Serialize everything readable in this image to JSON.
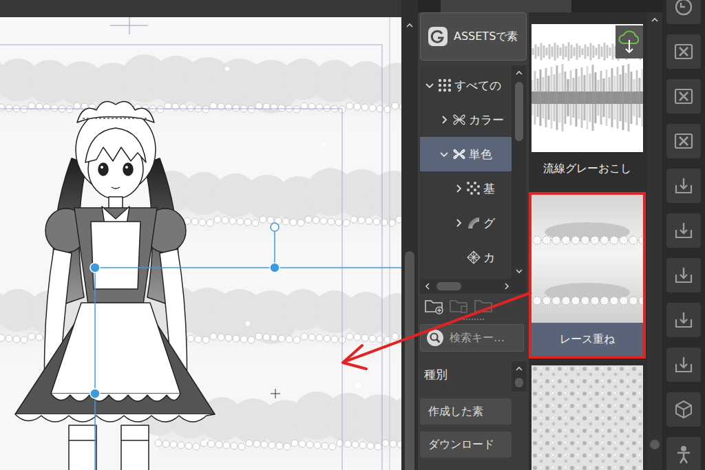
{
  "assets_button": {
    "label": "ASSETSで素"
  },
  "tree": [
    {
      "label": "すべての",
      "depth": 0,
      "kind": "all",
      "has_children": true,
      "expanded": true,
      "selected": false
    },
    {
      "label": "カラー",
      "depth": 1,
      "kind": "color",
      "has_children": true,
      "expanded": false,
      "selected": false
    },
    {
      "label": "単色",
      "depth": 1,
      "kind": "mono",
      "has_children": true,
      "expanded": true,
      "selected": true
    },
    {
      "label": "基",
      "depth": 2,
      "kind": "basic",
      "has_children": true,
      "expanded": false,
      "selected": false
    },
    {
      "label": "グ",
      "depth": 2,
      "kind": "gradient",
      "has_children": true,
      "expanded": false,
      "selected": false
    },
    {
      "label": "カ",
      "depth": 2,
      "kind": "pattern",
      "has_children": false,
      "expanded": false,
      "selected": false
    }
  ],
  "search": {
    "placeholder": "検索キー…"
  },
  "filter": {
    "label": "種別",
    "buttons": [
      {
        "label": "作成した素"
      },
      {
        "label": "ダウンロード"
      }
    ]
  },
  "materials": [
    {
      "label": "流線グレーおこし",
      "kind": "speedlines",
      "selected": false,
      "highlighted": false,
      "downloadable": true
    },
    {
      "label": "レース重ね",
      "kind": "lace",
      "selected": true,
      "highlighted": true,
      "downloadable": false
    },
    {
      "kind": "flowers",
      "selected": false,
      "highlighted": false,
      "downloadable": false
    }
  ],
  "annotation": {
    "arrow": true
  }
}
